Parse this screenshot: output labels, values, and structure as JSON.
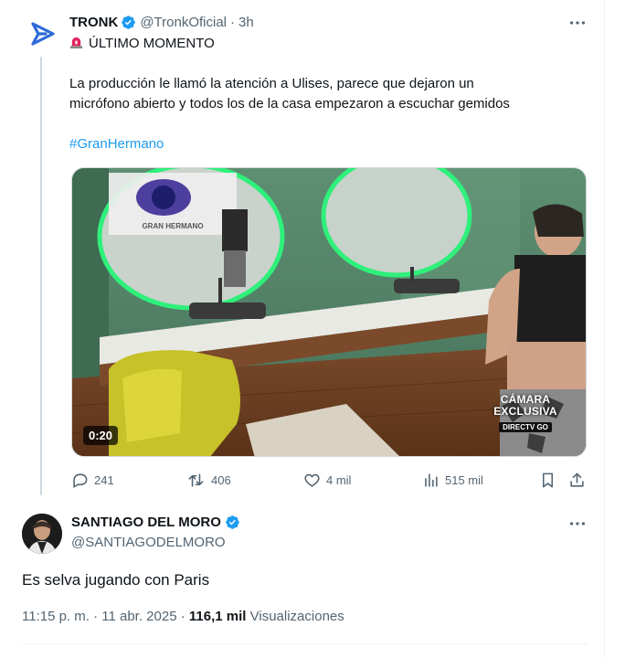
{
  "quoted_tweet": {
    "author_name": "TRONK",
    "handle": "@TronkOficial",
    "time": "3h",
    "headline": "ÚLTIMO MOMENTO",
    "body_line1": "La producción le llamó la atención a Ulises, parece que dejaron un",
    "body_line2": "micrófono abierto y todos los de la casa empezaron a escuchar gemidos",
    "hashtag": "#GranHermano",
    "video": {
      "duration": "0:20",
      "badge_line1": "CÁMARA",
      "badge_line2": "EXCLUSIVA",
      "badge_sub": "DIRECTV GO",
      "sign_text": "GRAN HERMANO"
    },
    "stats": {
      "replies": "241",
      "retweets": "406",
      "likes": "4 mil",
      "views": "515 mil"
    }
  },
  "main_tweet": {
    "author_name": "SANTIAGO DEL MORO",
    "handle": "@SANTIAGODELMORO",
    "text": "Es selva jugando con Paris",
    "timestamp": "11:15 p. m. · 11 abr. 2025",
    "views_count": "116,1 mil",
    "views_label": "Visualizaciones"
  },
  "colors": {
    "accent": "#1d9bf0",
    "text": "#0f1419",
    "muted": "#536471",
    "border": "#cfd9de",
    "tronk_logo": "#2f6bd8"
  },
  "icons": [
    "tronk-logo-icon",
    "verified-icon",
    "more-icon",
    "siren-icon",
    "reply-icon",
    "retweet-icon",
    "like-icon",
    "views-icon",
    "bookmark-icon",
    "share-icon"
  ]
}
